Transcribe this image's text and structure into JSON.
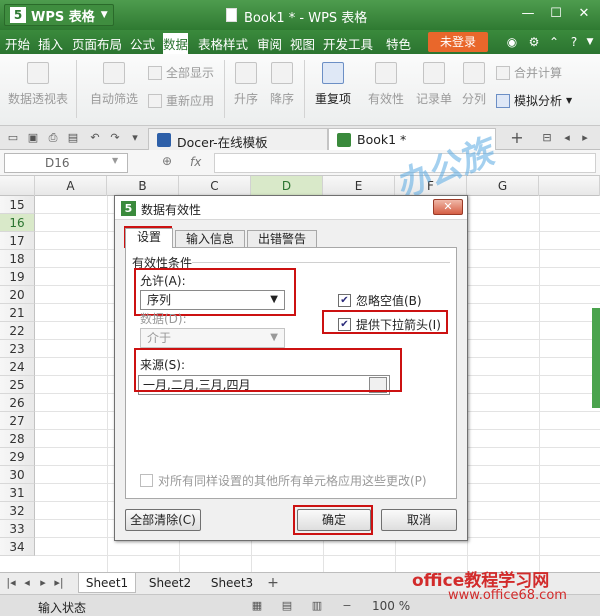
{
  "app": {
    "name": "WPS 表格",
    "window_title": "Book1 * - WPS 表格"
  },
  "menu": {
    "items": [
      "开始",
      "插入",
      "页面布局",
      "公式",
      "数据",
      "表格样式",
      "审阅",
      "视图",
      "开发工具",
      "特色"
    ],
    "active": "数据",
    "login": "未登录"
  },
  "ribbon": {
    "pivot": "数据透视表",
    "autofilter": "自动筛选",
    "show_all": "全部显示",
    "reapply": "重新应用",
    "asc": "升序",
    "desc": "降序",
    "duplicates": "重复项",
    "validity": "有效性",
    "record": "记录单",
    "split": "分列",
    "merge_calc": "合并计算",
    "simulate": "模拟分析"
  },
  "doc_tabs": [
    "Docer-在线模板",
    "Book1 *"
  ],
  "formula": {
    "cell_ref": "D16",
    "fx": "fx"
  },
  "sheet": {
    "columns": [
      "A",
      "B",
      "C",
      "D",
      "E",
      "F",
      "G"
    ],
    "rows": [
      "15",
      "16",
      "17",
      "18",
      "19",
      "20",
      "21",
      "22",
      "23",
      "24",
      "25",
      "26",
      "27",
      "28",
      "29",
      "30",
      "31",
      "32",
      "33",
      "34"
    ],
    "tabs": [
      "Sheet1",
      "Sheet2",
      "Sheet3"
    ]
  },
  "status": {
    "text": "输入状态",
    "zoom": "100 %"
  },
  "dialog": {
    "title": "数据有效性",
    "tabs": [
      "设置",
      "输入信息",
      "出错警告"
    ],
    "group": "有效性条件",
    "allow_label": "允许(A):",
    "allow_value": "序列",
    "data_label": "数据(D):",
    "data_value": "介于",
    "ignore_blank": "忽略空值(B)",
    "dropdown": "提供下拉箭头(I)",
    "source_label": "来源(S):",
    "source_value": "一月,二月,三月,四月",
    "apply_all": "对所有同样设置的其他所有单元格应用这些更改(P)",
    "clear_all": "全部清除(C)",
    "ok": "确定",
    "cancel": "取消"
  },
  "watermark": {
    "logo": "办公族",
    "site": "office教程学习网",
    "url": "www.office68.com"
  },
  "colors": {
    "accent": "#2f7a32",
    "highlight": "#cc1111",
    "login": "#e9672b"
  }
}
